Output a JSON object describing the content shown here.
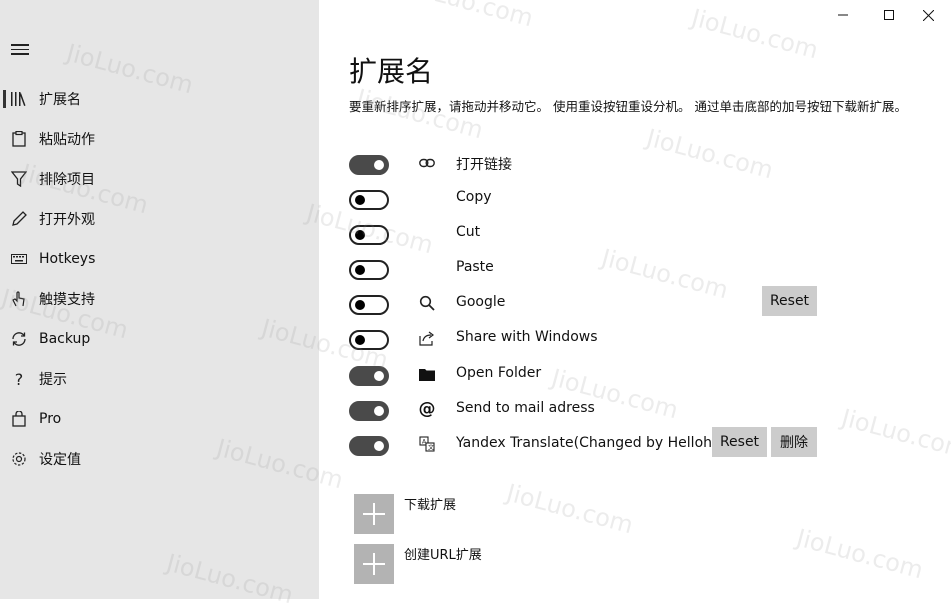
{
  "window": {
    "minimize_glyph": "—",
    "maximize_glyph": "☐",
    "close_glyph": "✕"
  },
  "sidebar": {
    "items": [
      {
        "label": "扩展名",
        "icon": "library-icon",
        "glyph": "⦀",
        "selected": true
      },
      {
        "label": "粘贴动作",
        "icon": "clipboard-icon",
        "glyph": "📋",
        "selected": false
      },
      {
        "label": "排除项目",
        "icon": "filter-icon",
        "glyph": "⛛",
        "selected": false
      },
      {
        "label": "打开外观",
        "icon": "pen-icon",
        "glyph": "✎",
        "selected": false
      },
      {
        "label": "Hotkeys",
        "icon": "keyboard-icon",
        "glyph": "⌨",
        "selected": false
      },
      {
        "label": "触摸支持",
        "icon": "touch-icon",
        "glyph": "☝",
        "selected": false
      },
      {
        "label": "Backup",
        "icon": "sync-icon",
        "glyph": "⟳",
        "selected": false
      },
      {
        "label": "提示",
        "icon": "question-icon",
        "glyph": "?",
        "selected": false
      },
      {
        "label": "Pro",
        "icon": "shopping-bag-icon",
        "glyph": "🛍",
        "selected": false
      },
      {
        "label": "设定值",
        "icon": "gear-icon",
        "glyph": "⚙",
        "selected": false
      }
    ]
  },
  "main": {
    "title": "扩展名",
    "description": "要重新排序扩展，请拖动并移动它。 使用重设按钮重设分机。 通过单击底部的加号按钮下载新扩展。",
    "extensions": [
      {
        "name": "打开链接",
        "enabled": true,
        "icon": "link-icon",
        "glyph": "🔗"
      },
      {
        "name": "Copy",
        "enabled": false,
        "icon": "",
        "glyph": ""
      },
      {
        "name": "Cut",
        "enabled": false,
        "icon": "",
        "glyph": ""
      },
      {
        "name": "Paste",
        "enabled": false,
        "icon": "",
        "glyph": ""
      },
      {
        "name": "Google",
        "enabled": false,
        "icon": "search-icon",
        "glyph": "🔍",
        "reset_label": "Reset"
      },
      {
        "name": "Share with Windows",
        "enabled": false,
        "icon": "share-icon",
        "glyph": "⇪"
      },
      {
        "name": "Open Folder",
        "enabled": true,
        "icon": "folder-icon",
        "glyph": "■"
      },
      {
        "name": "Send to mail adress",
        "enabled": true,
        "icon": "at-icon",
        "glyph": "@"
      },
      {
        "name": "Yandex Translate(Changed by Helloha",
        "enabled": true,
        "icon": "translate-icon",
        "glyph": "⛶",
        "reset_label": "Reset",
        "delete_label": "删除"
      }
    ],
    "actions": [
      {
        "label": "下载扩展",
        "icon": "plus-icon"
      },
      {
        "label": "创建URL扩展",
        "icon": "plus-icon"
      }
    ]
  },
  "watermark": "JioLuo.com",
  "colors": {
    "sidebar_bg": "#e6e6e6",
    "toggle_on": "#4a4a4a",
    "button_bg": "#cccccc",
    "add_box": "#b3b3b3"
  }
}
